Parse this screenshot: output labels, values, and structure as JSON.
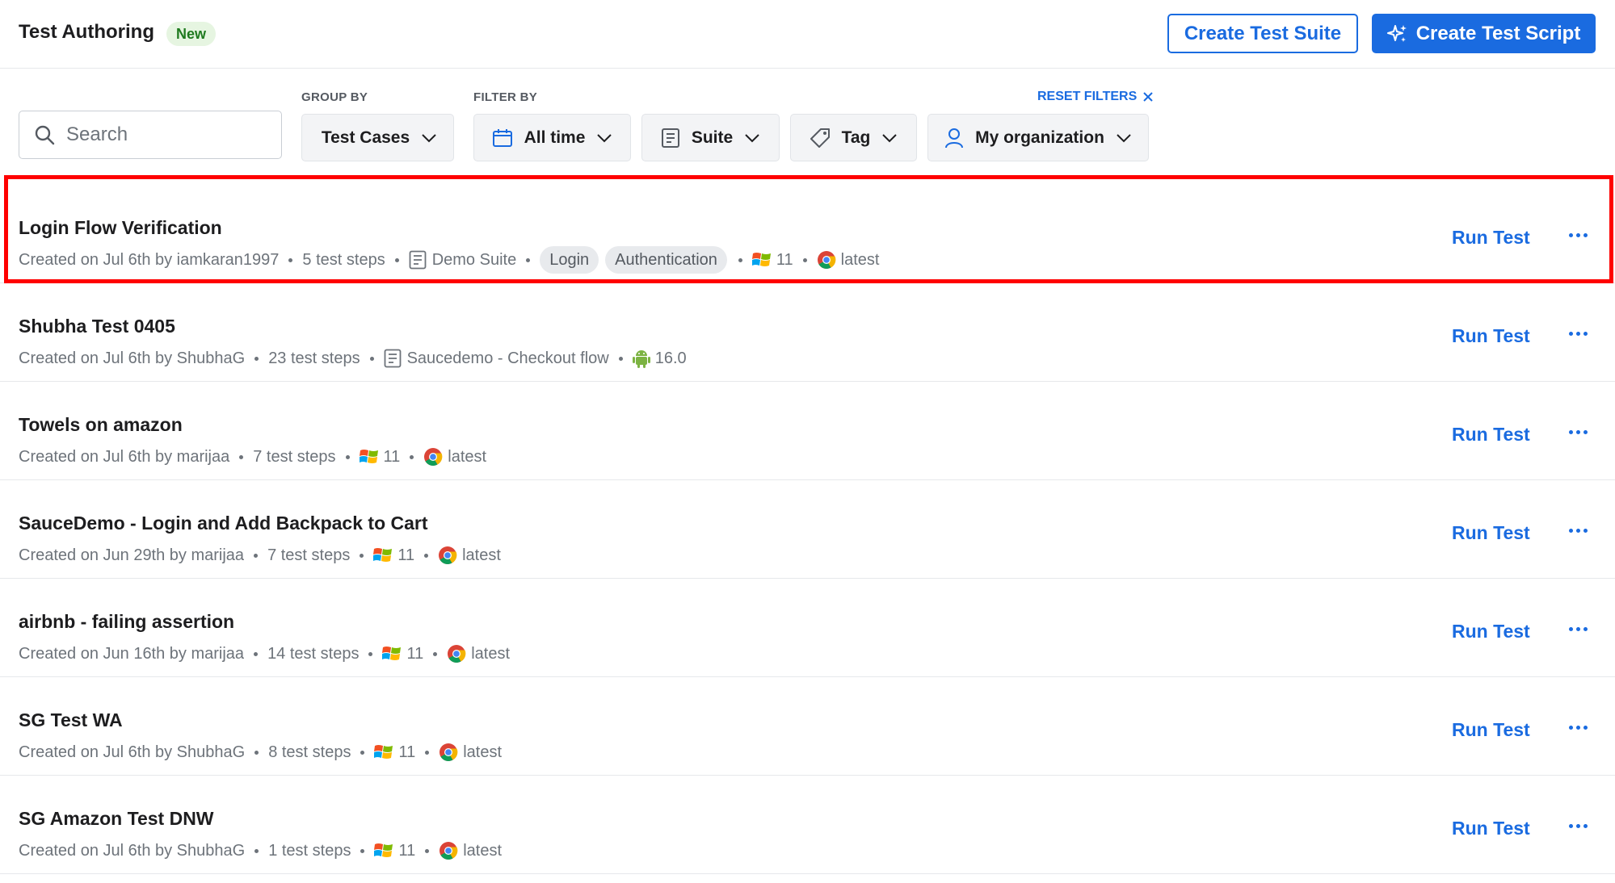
{
  "header": {
    "title": "Test Authoring",
    "badge": "New",
    "create_suite_label": "Create Test Suite",
    "create_script_label": "Create Test Script"
  },
  "filters": {
    "search_placeholder": "Search",
    "group_by_label": "GROUP BY",
    "filter_by_label": "FILTER BY",
    "reset_label": "RESET FILTERS",
    "group_by_value": "Test Cases",
    "time_value": "All time",
    "suite_value": "Suite",
    "tag_value": "Tag",
    "org_value": "My organization"
  },
  "run_label": "Run Test",
  "rows": [
    {
      "title": "Login Flow Verification",
      "created": "Created on Jul 6th by iamkaran1997",
      "steps": "5 test steps",
      "suite": "Demo Suite",
      "tags": [
        "Login",
        "Authentication"
      ],
      "os_icon": "windows-icon",
      "os_version": "11",
      "browser_icon": "chrome-icon",
      "browser_version": "latest"
    },
    {
      "title": "Shubha Test 0405",
      "created": "Created on Jul 6th by ShubhaG",
      "steps": "23 test steps",
      "suite": "Saucedemo - Checkout flow",
      "tags": [],
      "os_icon": "android-icon",
      "os_version": "16.0",
      "browser_icon": "",
      "browser_version": ""
    },
    {
      "title": "Towels on amazon",
      "created": "Created on Jul 6th by marijaa",
      "steps": "7 test steps",
      "suite": "",
      "tags": [],
      "os_icon": "windows-icon",
      "os_version": "11",
      "browser_icon": "chrome-icon",
      "browser_version": "latest"
    },
    {
      "title": "SauceDemo - Login and Add Backpack to Cart",
      "created": "Created on Jun 29th by marijaa",
      "steps": "7 test steps",
      "suite": "",
      "tags": [],
      "os_icon": "windows-icon",
      "os_version": "11",
      "browser_icon": "chrome-icon",
      "browser_version": "latest"
    },
    {
      "title": "airbnb - failing assertion",
      "created": "Created on Jun 16th by marijaa",
      "steps": "14 test steps",
      "suite": "",
      "tags": [],
      "os_icon": "windows-icon",
      "os_version": "11",
      "browser_icon": "chrome-icon",
      "browser_version": "latest"
    },
    {
      "title": "SG Test WA",
      "created": "Created on Jul 6th by ShubhaG",
      "steps": "8 test steps",
      "suite": "",
      "tags": [],
      "os_icon": "windows-icon",
      "os_version": "11",
      "browser_icon": "chrome-icon",
      "browser_version": "latest"
    },
    {
      "title": "SG Amazon Test DNW",
      "created": "Created on Jul 6th by ShubhaG",
      "steps": "1 test steps",
      "suite": "",
      "tags": [],
      "os_icon": "windows-icon",
      "os_version": "11",
      "browser_icon": "chrome-icon",
      "browser_version": "latest"
    }
  ],
  "colors": {
    "accent": "#1a6be0",
    "highlight": "#ff0000",
    "badge_bg": "#e6f5e1",
    "badge_text": "#1f7a1f"
  }
}
